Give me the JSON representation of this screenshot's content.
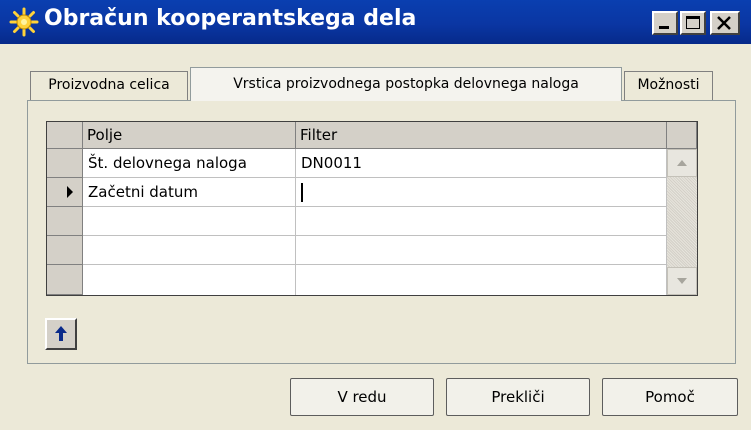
{
  "window": {
    "title": "Obračun kooperantskega dela",
    "controls": [
      "minimize",
      "maximize",
      "close"
    ]
  },
  "tabs": [
    {
      "label": "Proizvodna celica",
      "active": false
    },
    {
      "label": "Vrstica proizvodnega postopka delovnega naloga",
      "active": true
    },
    {
      "label": "Možnosti",
      "active": false
    }
  ],
  "grid": {
    "columns": [
      "Polje",
      "Filter"
    ],
    "rows": [
      {
        "field": "Št. delovnega naloga",
        "filter": "DN0011",
        "current": false
      },
      {
        "field": "Začetni datum",
        "filter": "",
        "current": true
      },
      {
        "field": "",
        "filter": "",
        "current": false
      },
      {
        "field": "",
        "filter": "",
        "current": false
      },
      {
        "field": "",
        "filter": "",
        "current": false
      }
    ]
  },
  "icons": {
    "app": "sun-gear-icon",
    "move_up": "arrow-up-icon",
    "row_pointer": "triangle-right-icon"
  },
  "buttons": {
    "ok": "V redu",
    "cancel": "Prekliči",
    "help": "Pomoč"
  },
  "colors": {
    "titlebar": "#0a36a3",
    "face": "#ece9d8"
  }
}
